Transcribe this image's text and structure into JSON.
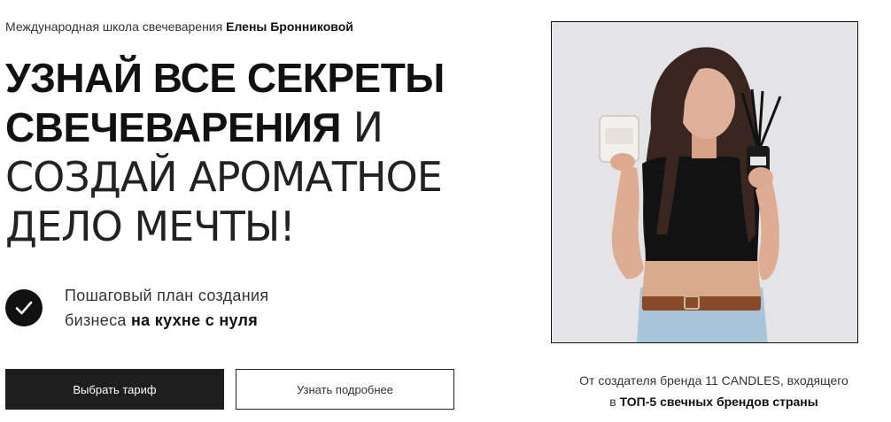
{
  "header": {
    "subtitle_prefix": "Международная школа свечеварения",
    "subtitle_name": "Елены Бронниковой"
  },
  "headline": {
    "line1": "УЗНАЙ ВСЕ СЕКРЕТЫ",
    "line2_bold": "СВЕЧЕВАРЕНИЯ",
    "line2_thin": " И",
    "line3": "СОЗДАЙ АРОМАТНОЕ",
    "line4": "ДЕЛО МЕЧТЫ!"
  },
  "feature": {
    "icon": "check-icon",
    "line1": "Пошаговый план создания",
    "line2_prefix": "бизнеса ",
    "line2_bold": "на кухне с нуля"
  },
  "buttons": {
    "primary_label": "Выбрать тариф",
    "secondary_label": "Узнать подробнее"
  },
  "caption": {
    "line1": "От создателя бренда 11 CANDLES, входящего",
    "line2_prefix": "в ",
    "line2_bold": "ТОП-5 свечных брендов страны"
  },
  "colors": {
    "text": "#111111",
    "button_dark": "#1e1e1e",
    "photo_background": "#e4e4e6"
  }
}
